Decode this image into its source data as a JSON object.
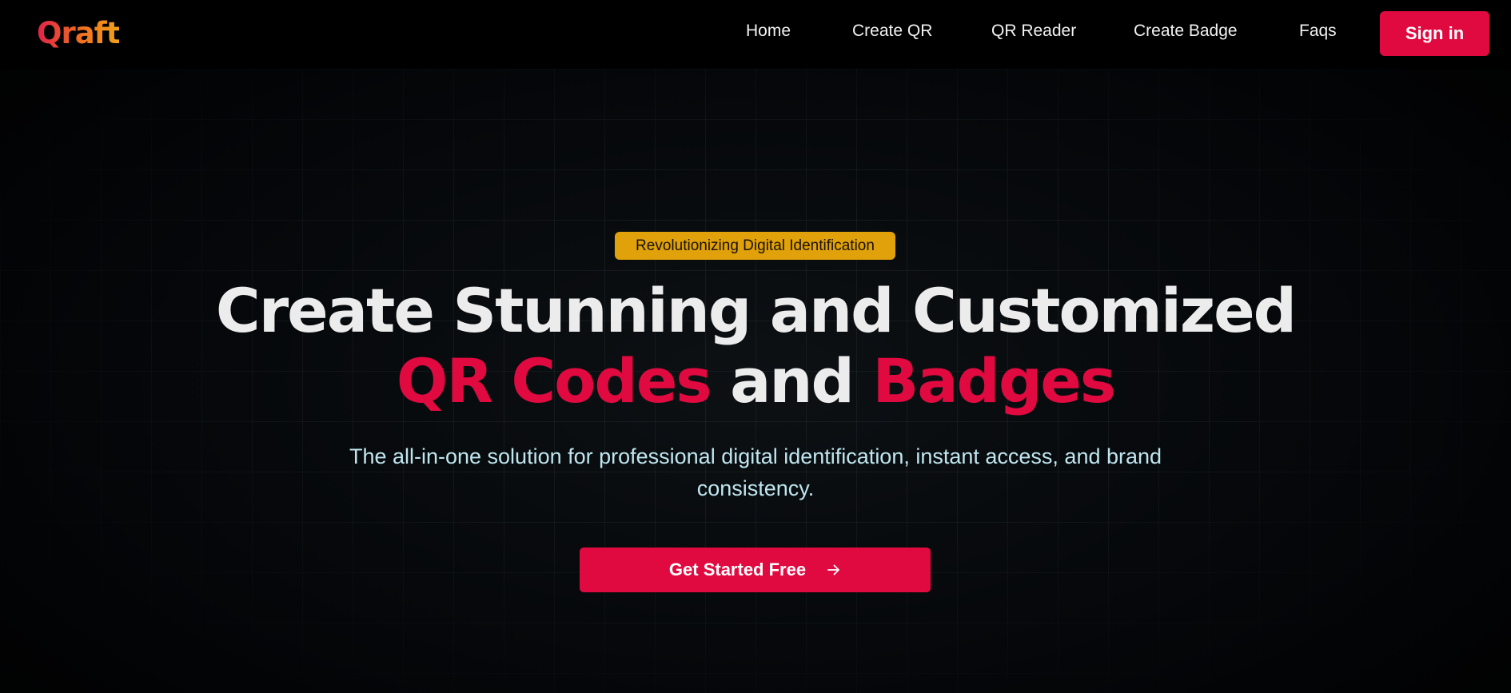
{
  "brand": {
    "logo_text": "Qraft"
  },
  "nav": {
    "links": [
      "Home",
      "Create QR",
      "QR Reader",
      "Create Badge",
      "Faqs"
    ],
    "signin_label": "Sign in"
  },
  "hero": {
    "badge": "Revolutionizing Digital Identification",
    "headline_line1": "Create Stunning and Customized",
    "headline_accent1": "QR Codes",
    "headline_mid": "and",
    "headline_accent2": "Badges",
    "subtitle": "The all-in-one solution for professional digital identification, instant access, and brand consistency.",
    "cta_label": "Get Started Free",
    "cta_icon": "arrow-right-icon"
  },
  "colors": {
    "accent": "#e10a40",
    "badge_bg": "#e0a10a",
    "subtitle": "#bfe6ef",
    "background": "#000000"
  }
}
